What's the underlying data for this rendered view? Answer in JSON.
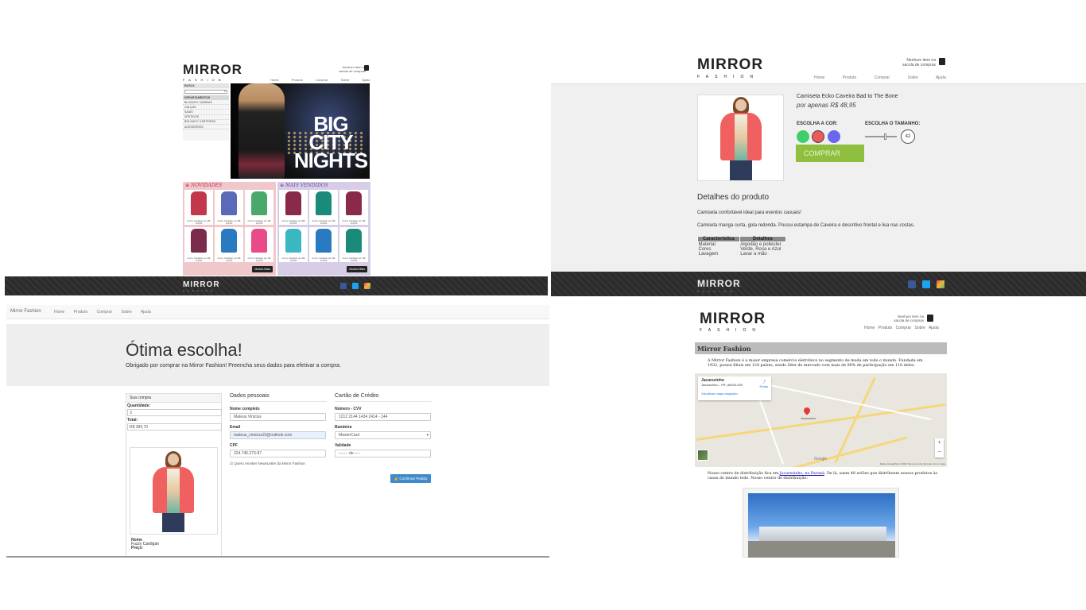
{
  "home": {
    "logo": "MIRROR",
    "logo_sub": "FASHION",
    "cart_text": "Nenhum item na sacola de compras",
    "nav": [
      "Home",
      "Produto",
      "Comprar",
      "Sobre",
      "Ajuda"
    ],
    "search_label": "BUSCA",
    "search_icon": "magnifier-icon",
    "departments_label": "DEPARTAMENTOS",
    "categories": [
      "BLUSAS E CAMISAS",
      "CALÇAS",
      "SAIAS",
      "VESTIDOS",
      "BOLSAS E CARTEIRAS",
      "ACESSÓRIOS"
    ],
    "banner_text": "BIG CITY NIGHTS",
    "novidades_label": "NOVIDADES",
    "mais_vendidos_label": "MAIS VENDIDOS",
    "product_caption": "Fuzzy Cardigan por R$ 129,90",
    "more_button": "Mostra Mais",
    "footer_logo": "MIRROR",
    "footer_logo_sub": "FASHION",
    "shirt_colors_novidades": [
      "#c2384a",
      "#5a6ab8",
      "#4aa86a",
      "#7a2a4a",
      "#2a7ac2",
      "#e84a8a"
    ],
    "shirt_colors_mais": [
      "#8a2a4a",
      "#1a8a7a",
      "#8a2a4a",
      "#3ab8c2",
      "#2a7ac2",
      "#1a8a7a"
    ]
  },
  "product": {
    "logo": "MIRROR",
    "logo_sub": "FASHION",
    "cart_text": "Nenhum item na sacola de compras",
    "nav": [
      "Home",
      "Produto",
      "Comprar",
      "Sobre",
      "Ajuda"
    ],
    "name": "Camiseta Ecko Caveira Bad to The Bone",
    "price": "por apenas R$ 48,95",
    "color_label": "ESCOLHA A COR:",
    "size_label": "ESCOLHA O TAMANHO:",
    "colors": [
      "#3fcf6a",
      "#ee5a5a",
      "#6a66f0"
    ],
    "size": "42",
    "buy_button": "COMPRAR",
    "details_title": "Detalhes do produto",
    "desc1": "Camiseta confortável ideal para eventos casuais!",
    "desc2": "Camiseta manga curta, gola redonda. Possui estampa de Caveira e descritivo frontal e lisa nas costas.",
    "table_headers": [
      "Característica",
      "Detalhes"
    ],
    "table_rows": [
      [
        "Material",
        "Algodão e poliester"
      ],
      [
        "Cores",
        "Verde, Rosa e Azul"
      ],
      [
        "Lavagem",
        "Lavar a mão"
      ]
    ],
    "footer_logo": "MIRROR",
    "footer_logo_sub": "FASHION"
  },
  "checkout": {
    "brand": "Mirror Fashion",
    "nav": [
      "Home",
      "Produto",
      "Comprar",
      "Sobre",
      "Ajuda"
    ],
    "heading": "Ótima escolha!",
    "subheading": "Obrigado por comprar na Mirror Fashion! Preencha seus dados para efetivar a compra.",
    "sua_compra": "Sua compra",
    "quantidade_label": "Quantidade:",
    "quantidade_value": "3",
    "total_label": "Total:",
    "total_value": "R$ 389,70",
    "item_nome_label": "Nome",
    "item_nome": "Fuzzy Cardigan",
    "item_preco_label": "Preço",
    "dados_title": "Dados pessoais",
    "nome_label": "Nome completo",
    "nome_value": "Mateus Vinicius",
    "email_label": "Email",
    "email_value": "mateus_vinicius15@outlook.com",
    "cpf_label": "CPF",
    "cpf_value": "324.745.273-87",
    "newsletter": "Quero receber NewsLetter da Mirror Fashion",
    "cartao_title": "Cartão de Crédito",
    "numero_label": "Número - CVV",
    "numero_value": "1212 2144 1434 2414 - 144",
    "bandeira_label": "Bandeira",
    "bandeira_value": "MasterCard",
    "validade_label": "Validade",
    "validade_value": "------- de ----",
    "confirm_button": "Confirmar Pedido"
  },
  "about": {
    "logo": "MIRROR",
    "logo_sub": "FASHION",
    "cart_text": "Nenhum item na sacola de compras",
    "nav": [
      "Home",
      "Produto",
      "Comprar",
      "Sobre",
      "Ajuda"
    ],
    "section_title": "Mirror Fashion",
    "para1": "A Mirror Fashion é a maior empresa comércio eletrônico no segmento de moda em todo o mundo. Fundada em 1932, possui filiais em 124 países, sendo líder de mercado com mais de 90% de participação em 118 deles.",
    "map_place": "Jacarezinho",
    "map_address": "Jacarezinho - PR, 86400-000",
    "map_routes": "Rotas",
    "map_link": "Visualizar mapa ampliado",
    "map_pin_label": "Jacarezinho",
    "map_google": "Google",
    "map_attribution": "Dados cartográficos ©2022   Termos de Uso   Informar erro no mapa",
    "para2_a": "Nosso centro de distribuição fica em",
    "para2_link": "Jacarezinho, no Paraná",
    "para2_b": ". De lá, saem 48 aviões que distribuem nossos produtos às casas do mundo todo. Nosso centro de distribuição:"
  }
}
